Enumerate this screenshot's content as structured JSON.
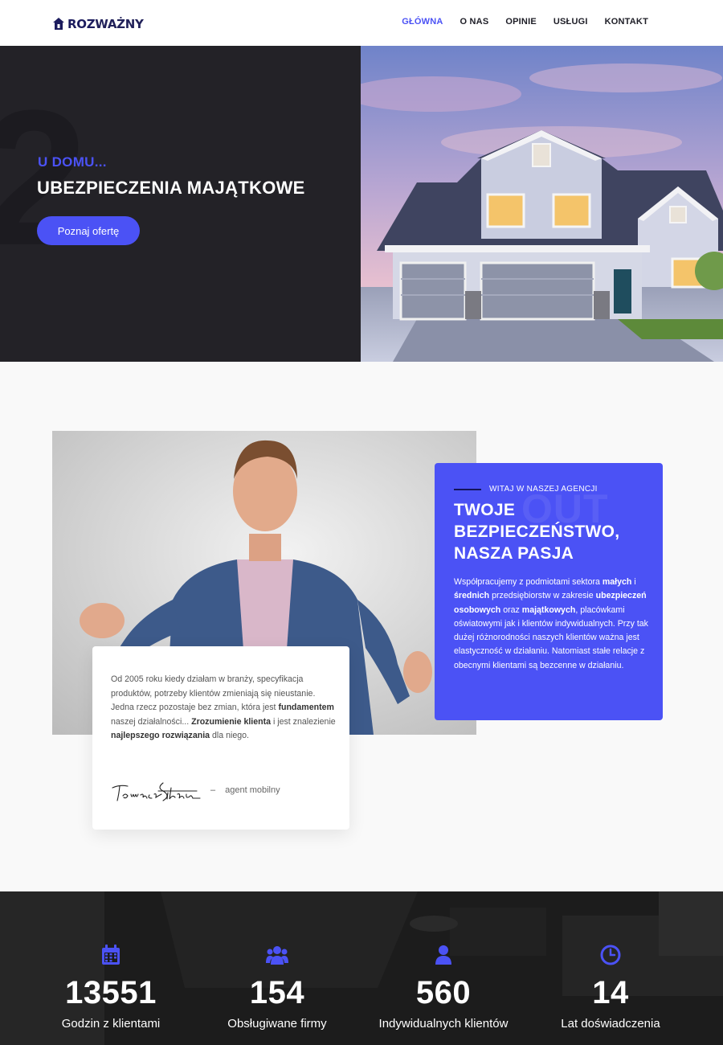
{
  "header": {
    "logo": {
      "prefix": "ROZ",
      "suffix": "WAŻNY"
    },
    "nav": [
      {
        "label": "GŁÓWNA",
        "active": true
      },
      {
        "label": "O NAS",
        "active": false
      },
      {
        "label": "OPINIE",
        "active": false
      },
      {
        "label": "USŁUGI",
        "active": false
      },
      {
        "label": "KONTAKT",
        "active": false
      }
    ]
  },
  "hero": {
    "big_number": "2",
    "subtitle": "U DOMU...",
    "title": "UBEZPIECZENIA MAJĄTKOWE",
    "button_label": "Poznaj ofertę"
  },
  "agency": {
    "eyebrow": "WITAJ W NASZEJ AGENCJI",
    "ghost_word": "OUT",
    "title_lines": [
      "TWOJE",
      "BEZPIECZEŃSTWO,",
      "NASZA PASJA"
    ],
    "text": [
      {
        "t": "Współpracujemy z podmiotami sektora ",
        "b": false
      },
      {
        "t": "małych",
        "b": true
      },
      {
        "t": " i ",
        "b": false
      },
      {
        "t": "średnich",
        "b": true
      },
      {
        "t": " przedsiębiorstw w zakresie ",
        "b": false
      },
      {
        "t": "ubezpieczeń osobowych",
        "b": true
      },
      {
        "t": " oraz ",
        "b": false
      },
      {
        "t": "majątkowych",
        "b": true
      },
      {
        "t": ", placówkami oświatowymi jak i klientów indywidualnych. Przy tak dużej różnorodności naszych klientów ważna jest elastyczność w działaniu. Natomiast stałe relacje z obecnymi  klientami są bezcenne w działaniu.",
        "b": false
      }
    ]
  },
  "quote": {
    "text": [
      {
        "t": "Od 2005 roku kiedy działam w branży,  specyfikacja produktów, potrzeby klientów zmieniają się nieustanie. Jedna rzecz pozostaje bez zmian, która jest ",
        "b": false
      },
      {
        "t": "fundamentem",
        "b": true
      },
      {
        "t": " naszej działalności... ",
        "b": false
      },
      {
        "t": "Zrozumienie klienta",
        "b": true
      },
      {
        "t": " i jest znalezienie ",
        "b": false
      },
      {
        "t": "najlepszego rozwiązania",
        "b": true
      },
      {
        "t": " dla niego.",
        "b": false
      }
    ],
    "signature": "Tomasz Sikora",
    "dash": "–",
    "role": "agent mobilny"
  },
  "stats": [
    {
      "icon": "calendar-icon",
      "value": "13551",
      "label": "Godzin z klientami"
    },
    {
      "icon": "group-icon",
      "value": "154",
      "label": "Obsługiwane firmy"
    },
    {
      "icon": "user-icon",
      "value": "560",
      "label": "Indywidualnych klientów"
    },
    {
      "icon": "clock-icon",
      "value": "14",
      "label": "Lat doświadczenia"
    }
  ],
  "colors": {
    "accent": "#4b52f5",
    "dark": "#232227",
    "logo": "#1c1c5e",
    "stats_bg": "#1b1b1b"
  }
}
